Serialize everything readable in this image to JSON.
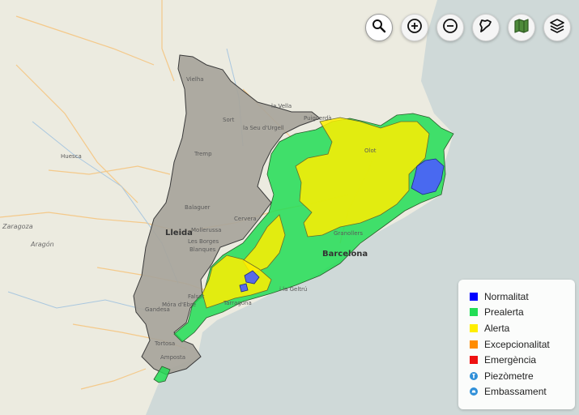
{
  "map": {
    "places": {
      "vielha": "Vielha",
      "la_vella": "la Vella",
      "puigcerda": "Puigcerdà",
      "sort": "Sort",
      "seu": "la Seu d'Urgell",
      "tremp": "Tremp",
      "huesca": "Huesca",
      "balaguer": "Balaguer",
      "zaragoza": "Zaragoza",
      "aragon": "Aragón",
      "lleida": "Lleida",
      "mollerussa": "Mollerussa",
      "cervera": "Cervera",
      "borges": "Les Borges",
      "blanques": "Blanques",
      "barcelona": "Barcelona",
      "tarragona": "Tarragona",
      "gandesa": "Gandesa",
      "mora": "Móra d'Ebre",
      "tortosa": "Tortosa",
      "amposta": "Amposta",
      "olot": "Olot",
      "geltru": "i la Geltrú",
      "falset": "Falset",
      "granollers": "Granollers"
    }
  },
  "toolbar": {
    "buttons": [
      {
        "name": "search",
        "icon": "search-icon"
      },
      {
        "name": "zoom-in",
        "icon": "zoom-in-icon"
      },
      {
        "name": "zoom-out",
        "icon": "zoom-out-icon"
      },
      {
        "name": "catalonia-outline",
        "icon": "region-outline-icon"
      },
      {
        "name": "basemap",
        "icon": "map-icon"
      },
      {
        "name": "layers",
        "icon": "layers-icon"
      }
    ]
  },
  "legend": {
    "items": [
      {
        "label": "Normalitat",
        "color": "#0000ff",
        "kind": "square"
      },
      {
        "label": "Prealerta",
        "color": "#22dd55",
        "kind": "square"
      },
      {
        "label": "Alerta",
        "color": "#ffee00",
        "kind": "square"
      },
      {
        "label": "Excepcionalitat",
        "color": "#ff8c00",
        "kind": "square"
      },
      {
        "label": "Emergència",
        "color": "#ee1111",
        "kind": "square"
      },
      {
        "label": "Piezòmetre",
        "color": "#2f8fd8",
        "kind": "piezometer-icon"
      },
      {
        "label": "Embassament",
        "color": "#2f8fd8",
        "kind": "reservoir-icon"
      }
    ]
  }
}
